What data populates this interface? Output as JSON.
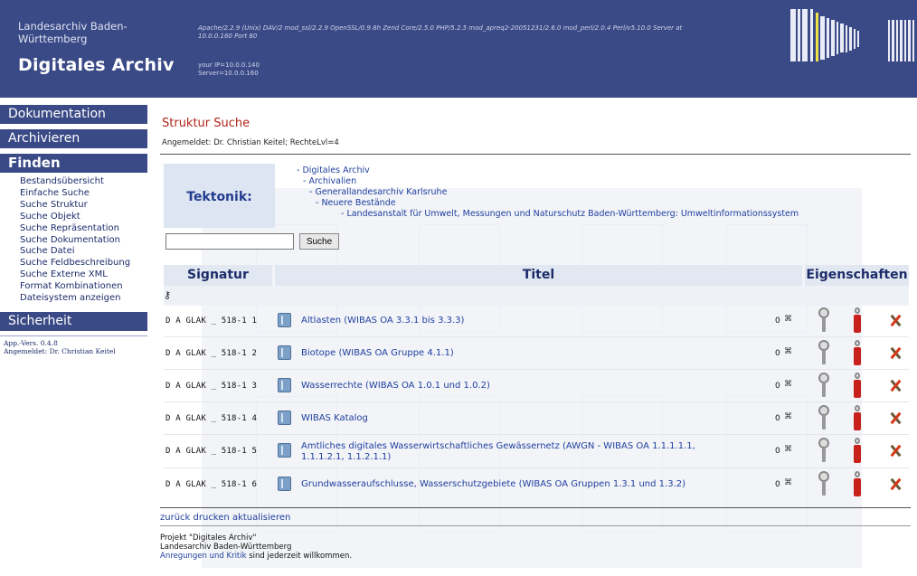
{
  "header": {
    "org_line1": "Landesarchiv Baden-",
    "org_line2": "Württemberg",
    "app_title": "Digitales Archiv",
    "server_line1": "Apache/2.2.9 (Unix) DAV/2 mod_ssl/2.2.9 OpenSSL/0.9.8h Zend Core/2.5.0 PHP/5.2.5 mod_apreq2-20051231/2.6.0 mod_perl/2.0.4 Perl/v5.10.0 Server at",
    "server_line2": "10.0.0.160 Port 80",
    "ip_line1": "your IP=10.0.0.140",
    "ip_line2": "Server=10.0.0.160"
  },
  "sidebar": {
    "sections": [
      "Dokumentation",
      "Archivieren",
      "Finden",
      "Sicherheit"
    ],
    "finden_items": [
      "Bestandsübersicht",
      "Einfache Suche",
      "Suche Struktur",
      "Suche Objekt",
      "Suche Repräsentation",
      "Suche Dokumentation",
      "Suche Datei",
      "Suche Feldbeschreibung",
      "Suche Externe XML",
      "Format Kombinationen",
      "Dateisystem anzeigen"
    ],
    "version": "App.-Vers. 0.4.8",
    "logged_in": "Angemeldet: Dr. Christian Keitel"
  },
  "main": {
    "title": "Struktur Suche",
    "logged_in": "Angemeldet: Dr. Christian Keitel; RechteLvl=4",
    "tektonik_label": "Tektonik:",
    "tree": [
      "- Digitales Archiv",
      "- Archivalien",
      "- Generallandesarchiv Karlsruhe",
      "- Neuere Bestände",
      "- Landesanstalt für Umwelt, Messungen und Naturschutz Baden-Württemberg: Umweltinformationssystem"
    ],
    "search": {
      "value": "",
      "button": "Suche"
    },
    "table": {
      "headers": [
        "Signatur",
        "Titel",
        "Eigenschaften"
      ],
      "rows": [
        {
          "signatur": "D A GLAK _ 518-1 1",
          "title_line1": "Altlasten (WIBAS OA 3.3.1 bis 3.3.3)",
          "title_line2": "",
          "count": "0"
        },
        {
          "signatur": "D A GLAK _ 518-1 2",
          "title_line1": "Biotope (WIBAS OA Gruppe 4.1.1)",
          "title_line2": "",
          "count": "0"
        },
        {
          "signatur": "D A GLAK _ 518-1 3",
          "title_line1": "Wasserrechte (WIBAS OA 1.0.1 und 1.0.2)",
          "title_line2": "",
          "count": "0"
        },
        {
          "signatur": "D A GLAK _ 518-1 4",
          "title_line1": "WIBAS Katalog",
          "title_line2": "",
          "count": "0"
        },
        {
          "signatur": "D A GLAK _ 518-1 5",
          "title_line1": "Amtliches digitales Wasserwirtschaftliches Gewässernetz (AWGN - WIBAS OA 1.1.1.1.1,",
          "title_line2": "1.1.1.2.1, 1.1.2.1.1)",
          "count": "0"
        },
        {
          "signatur": "D A GLAK _ 518-1 6",
          "title_line1": "Grundwasseraufschlusse, Wasserschutzgebiete (WIBAS OA Gruppen 1.3.1 und 1.3.2)",
          "title_line2": "",
          "count": "0"
        }
      ]
    },
    "footer_links": [
      "zurück",
      "drucken",
      "aktualisieren"
    ],
    "footer": {
      "line1": "Projekt \"Digitales Archiv\"",
      "line2": "Landesarchiv Baden-Württemberg",
      "link1": "Anregungen",
      "link_and": "und",
      "link2": "Kritik",
      "tail": "sind jederzeit willkommen."
    }
  },
  "colors": {
    "brand": "#3a4a86",
    "title": "#b02418",
    "link": "#1f3f9f",
    "header_band": "#e2e8f1"
  },
  "icons": [
    "book-icon",
    "link-icon",
    "key-icon",
    "extinguisher-icon",
    "tools-icon"
  ]
}
